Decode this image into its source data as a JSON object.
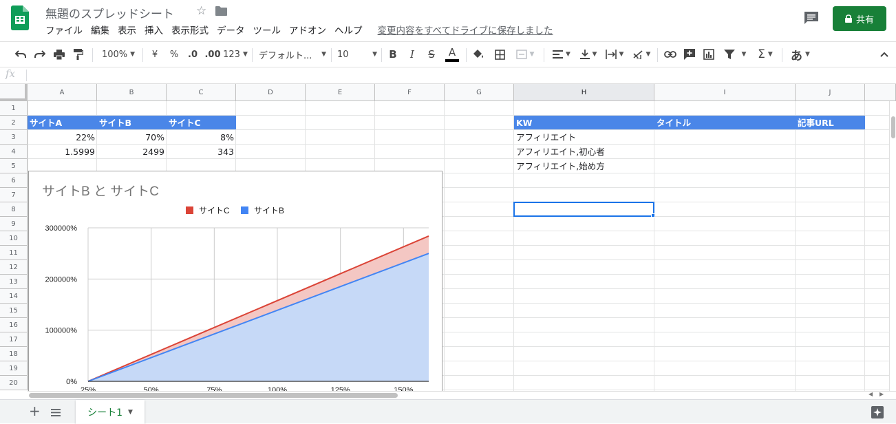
{
  "doc": {
    "title": "無題のスプレッドシート",
    "save_status": "変更内容をすべてドライブに保存しました"
  },
  "menu": [
    "ファイル",
    "編集",
    "表示",
    "挿入",
    "表示形式",
    "データ",
    "ツール",
    "アドオン",
    "ヘルプ"
  ],
  "share": {
    "label": "共有"
  },
  "toolbar": {
    "zoom": "100%",
    "currency": "¥",
    "percent": "%",
    "dec_less": ".0",
    "dec_more": ".00",
    "more_formats": "123",
    "font": "デフォルト...",
    "font_size": "10",
    "input_tool": "あ"
  },
  "formula": {
    "label": "fx"
  },
  "columns": [
    "A",
    "B",
    "C",
    "D",
    "E",
    "F",
    "G",
    "H",
    "I",
    "J"
  ],
  "rows": [
    "1",
    "2",
    "3",
    "4",
    "5",
    "6",
    "7",
    "8",
    "9",
    "10",
    "11",
    "12",
    "13",
    "14",
    "15",
    "16",
    "17",
    "18",
    "19",
    "20"
  ],
  "cells": {
    "A2": "サイトA",
    "B2": "サイトB",
    "C2": "サイトC",
    "A3": "22%",
    "B3": "70%",
    "C3": "8%",
    "A4": "1.5999",
    "B4": "2499",
    "C4": "343",
    "H2": "KW",
    "I2": "タイトル",
    "J2": "記事URL",
    "H3": "アフィリエイト",
    "H4": "アフィリエイト,初心者",
    "H5": "アフィリエイト,始め方"
  },
  "chart_data": {
    "type": "area",
    "title": "サイトB と サイトC",
    "legend": "top",
    "x": [
      25,
      160
    ],
    "x_ticks": [
      "25%",
      "50%",
      "75%",
      "100%",
      "125%",
      "150%"
    ],
    "y_ticks": [
      "0%",
      "100000%",
      "200000%",
      "300000%"
    ],
    "ylim": [
      0,
      300000
    ],
    "series": [
      {
        "name": "サイトC",
        "values": [
          0,
          284000
        ],
        "color": "#db4437",
        "fill": "#f4c7c3"
      },
      {
        "name": "サイトB",
        "values": [
          0,
          250000
        ],
        "color": "#4285f4",
        "fill": "#c6d9f7"
      }
    ]
  },
  "sheets": [
    {
      "name": "シート1"
    }
  ],
  "colors": {
    "brand_green": "#188038",
    "header_blue": "#4a86e8",
    "selection": "#1a73e8"
  }
}
